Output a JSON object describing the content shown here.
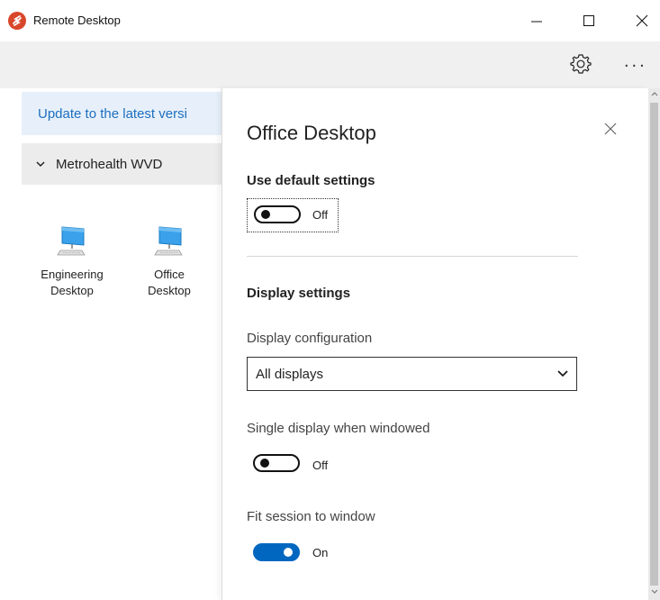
{
  "window": {
    "title": "Remote Desktop",
    "icon": "remote-desktop-app-icon",
    "controls": {
      "minimize": "minimize-icon",
      "maximize": "maximize-icon",
      "close": "close-icon"
    }
  },
  "toolbar": {
    "settings_icon": "gear-icon",
    "more_label": "..."
  },
  "sidebar": {
    "update_banner": "Update to the latest versi",
    "group": {
      "label": "Metrohealth WVD",
      "expanded": true
    },
    "desktops": [
      {
        "line1": "Engineering",
        "line2": "Desktop",
        "icon": "computer-icon"
      },
      {
        "line1": "Office",
        "line2": "Desktop",
        "icon": "computer-icon"
      }
    ]
  },
  "panel": {
    "title": "Office Desktop",
    "use_default": {
      "heading": "Use default settings",
      "state": "Off",
      "on": false
    },
    "display": {
      "heading": "Display settings",
      "config_label": "Display configuration",
      "config_value": "All displays",
      "single_label": "Single display when windowed",
      "single_state": "Off",
      "single_on": false,
      "fit_label": "Fit session to window",
      "fit_state": "On",
      "fit_on": true
    }
  },
  "colors": {
    "accent": "#0067c0",
    "banner_bg": "#e7f0fa",
    "banner_text": "#1d6fbf",
    "app_icon": "#d9472a"
  }
}
